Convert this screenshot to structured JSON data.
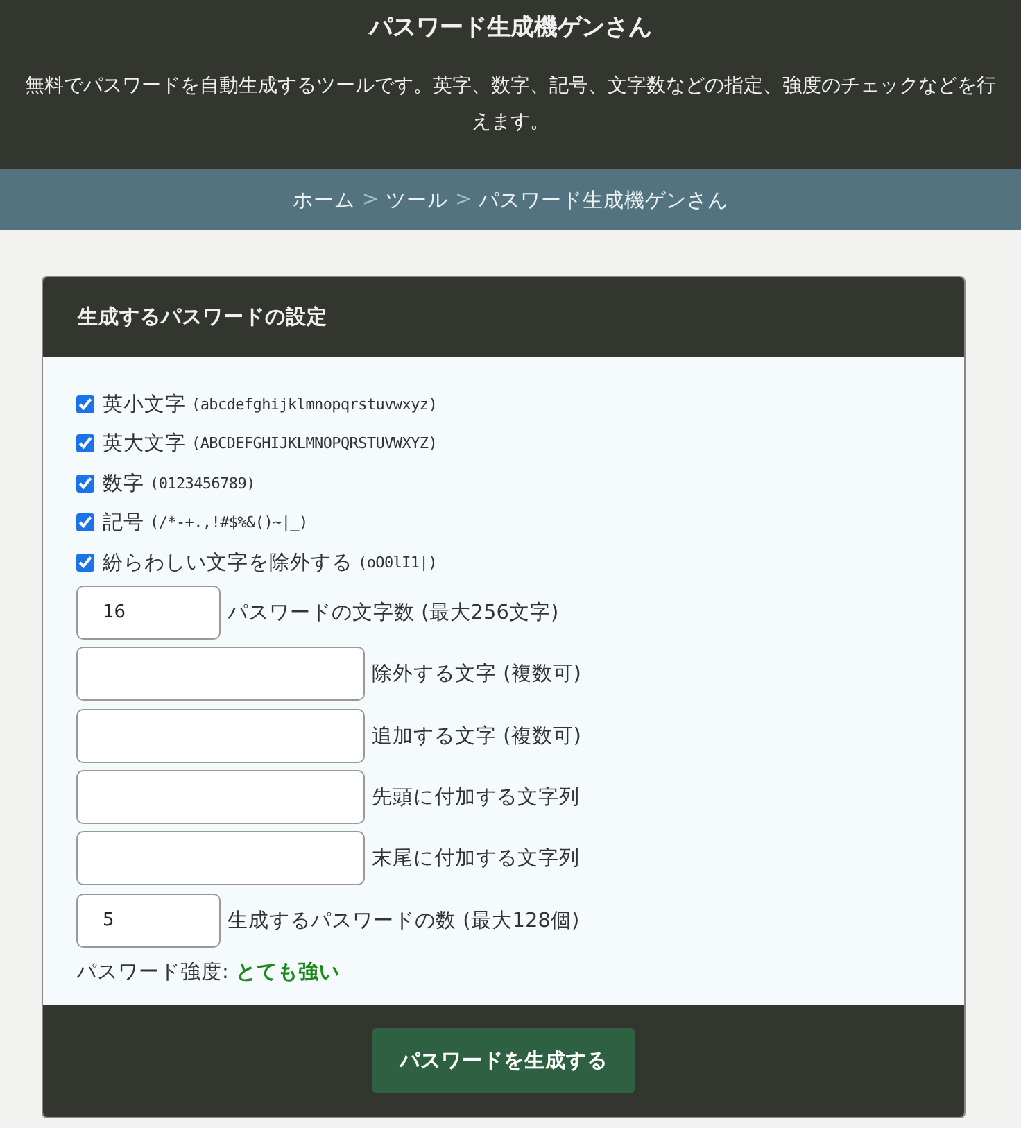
{
  "header": {
    "title": "パスワード生成機ゲンさん",
    "description": "無料でパスワードを自動生成するツールです。英字、数字、記号、文字数などの指定、強度のチェックなどを行えます。"
  },
  "breadcrumb": {
    "separator": ">",
    "items": [
      "ホーム",
      "ツール",
      "パスワード生成機ゲンさん"
    ]
  },
  "settings": {
    "title": "生成するパスワードの設定",
    "options": [
      {
        "label": "英小文字",
        "sample": "(abcdefghijklmnopqrstuvwxyz)",
        "checked": true
      },
      {
        "label": "英大文字",
        "sample": "(ABCDEFGHIJKLMNOPQRSTUVWXYZ)",
        "checked": true
      },
      {
        "label": "数字",
        "sample": "(0123456789)",
        "checked": true
      },
      {
        "label": "記号",
        "sample": "(/*-+.,!#$%&()~|_)",
        "checked": true
      },
      {
        "label": "紛らわしい文字を除外する",
        "sample": "(oO0lI1|)",
        "checked": true
      }
    ],
    "fields": [
      {
        "kind": "number",
        "value": "16",
        "label": "パスワードの文字数 (最大256文字)"
      },
      {
        "kind": "text",
        "label": "除外する文字 (複数可)"
      },
      {
        "kind": "text",
        "label": "追加する文字 (複数可)"
      },
      {
        "kind": "text",
        "label": "先頭に付加する文字列"
      },
      {
        "kind": "text",
        "label": "末尾に付加する文字列"
      },
      {
        "kind": "number",
        "value": "5",
        "label": "生成するパスワードの数 (最大128個)"
      }
    ],
    "strength": {
      "label": "パスワード強度:",
      "value": "とても強い",
      "color": "#1a8a1a"
    },
    "button": "パスワードを生成する"
  }
}
